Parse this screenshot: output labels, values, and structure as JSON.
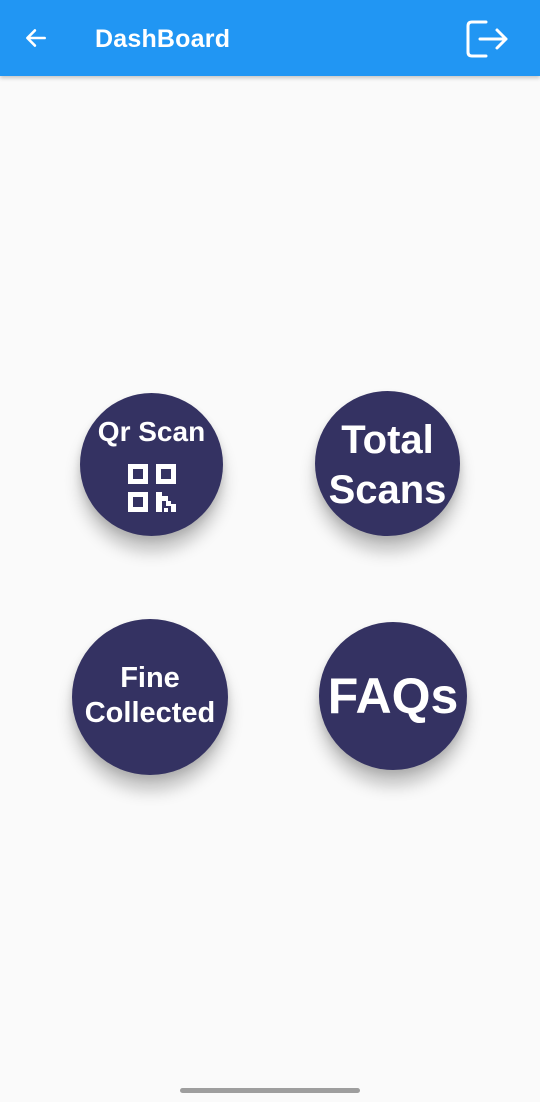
{
  "app_bar": {
    "title": "DashBoard",
    "back_icon": "arrow-left-icon",
    "logout_icon": "logout-icon",
    "color": "#2196f3"
  },
  "tiles": [
    {
      "label": "Qr Scan",
      "icon": "qr-code-icon"
    },
    {
      "label_line1": "Total",
      "label_line2": "Scans"
    },
    {
      "label_line1": "Fine",
      "label_line2": "Collected"
    },
    {
      "label": "FAQs"
    }
  ],
  "colors": {
    "tile": "#343262",
    "background": "#fafafa",
    "text_on_primary": "#ffffff"
  }
}
